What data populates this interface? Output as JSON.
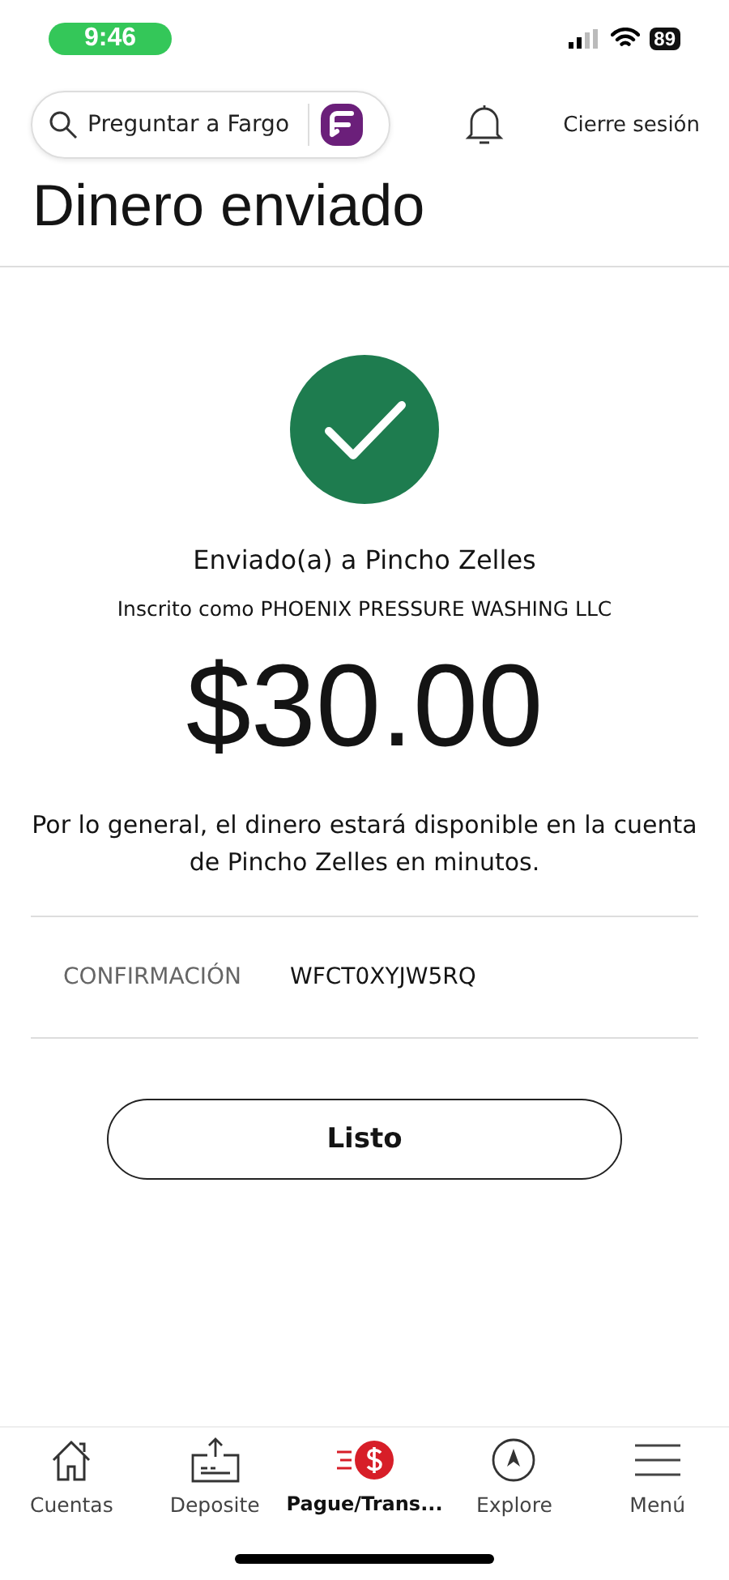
{
  "status_bar": {
    "time": "9:46",
    "battery": "89"
  },
  "header": {
    "search": {
      "placeholder": "Preguntar a Fargo"
    },
    "logout": "Cierre sesión"
  },
  "title": "Dinero enviado",
  "result": {
    "recipient": "Enviado(a) a Pincho Zelles",
    "enrolled": "Inscrito como PHOENIX PRESSURE WASHING LLC",
    "amount": "$30.00",
    "message": "Por lo general, el dinero estará disponible en la cuenta de Pincho Zelles en minutos."
  },
  "confirmation": {
    "label": "CONFIRMACIÓN",
    "value": "WFCT0XYJW5RQ"
  },
  "done_button": "Listo",
  "tabs": [
    {
      "kind": "home",
      "label": "Cuentas",
      "selected": false
    },
    {
      "kind": "deposit",
      "label": "Deposite",
      "selected": false
    },
    {
      "kind": "pay",
      "label": "Pague/Trans...",
      "selected": true
    },
    {
      "kind": "explore",
      "label": "Explore",
      "selected": false
    },
    {
      "kind": "menu",
      "label": "Menú",
      "selected": false
    }
  ]
}
